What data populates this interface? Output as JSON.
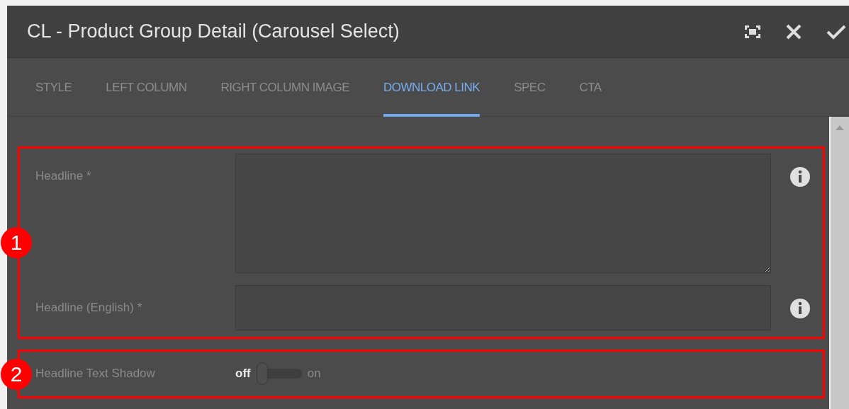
{
  "dialog": {
    "title": "CL - Product Group Detail (Carousel Select)"
  },
  "tabs": [
    {
      "label": "STYLE",
      "selected": false
    },
    {
      "label": "LEFT COLUMN",
      "selected": false
    },
    {
      "label": "RIGHT COLUMN IMAGE",
      "selected": false
    },
    {
      "label": "DOWNLOAD LINK",
      "selected": true
    },
    {
      "label": "SPEC",
      "selected": false
    },
    {
      "label": "CTA",
      "selected": false
    }
  ],
  "sections": [
    {
      "marker": "1",
      "fields": [
        {
          "kind": "textarea",
          "label": "Headline *"
        },
        {
          "kind": "text",
          "label": "Headline (English) *"
        }
      ]
    },
    {
      "marker": "2",
      "fields": [
        {
          "kind": "toggle",
          "label": "Headline Text Shadow",
          "off_label": "off",
          "on_label": "on",
          "on": false
        }
      ]
    }
  ]
}
